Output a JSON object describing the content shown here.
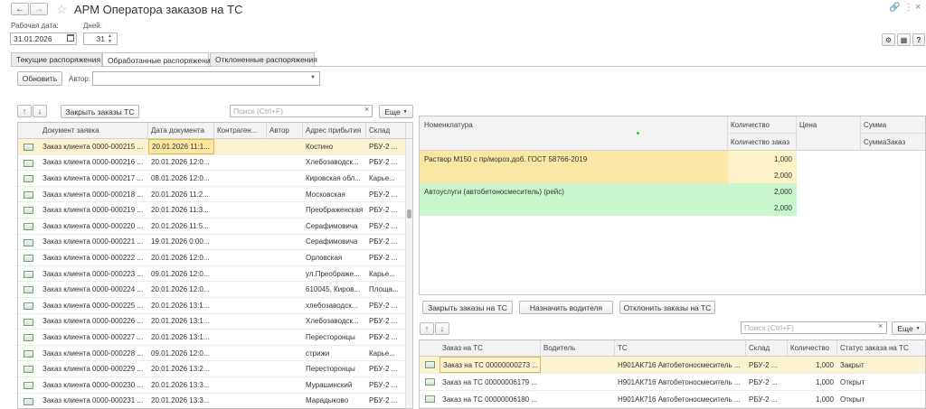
{
  "window": {
    "title": "АРМ Оператора заказов на ТС",
    "back_icon": "arrow-left-icon",
    "forward_icon": "arrow-right-icon",
    "star_icon": "star-icon"
  },
  "header": {
    "date_label": "Рабочая дата:",
    "date_value": "31.01.2026",
    "days_label": "Дней:",
    "days_value": "31"
  },
  "tabs": [
    {
      "label": "Текущие распоряжения"
    },
    {
      "label": "Обработанные распоряжения"
    },
    {
      "label": "Отклоненные распоряжения"
    }
  ],
  "toolbar": {
    "refresh_label": "Обновить",
    "author_label": "Автор:",
    "author_value": "",
    "close_orders_label": "Закрыть заказы ТС",
    "search_placeholder": "Поиск (Ctrl+F)",
    "more_label": "Еще"
  },
  "left_table": {
    "columns": [
      "Документ заявка",
      "Дата документа",
      "Контраген...",
      "Автор",
      "Адрес прибытия",
      "Склад"
    ],
    "rows": [
      [
        "Заказ клиента 0000-000215 ...",
        "20.01.2026 11:1...",
        "",
        "",
        "Костино",
        "РБУ-2 ..."
      ],
      [
        "Заказ клиента 0000-000216 ...",
        "20.01.2026 12:0...",
        "",
        "",
        "Хлебозаводск...",
        "РБУ-2 ..."
      ],
      [
        "Заказ клиента 0000-000217 ...",
        "08.01.2026 12:0...",
        "",
        "",
        "Кировская обл...",
        "Карье..."
      ],
      [
        "Заказ клиента 0000-000218 ...",
        "20.01.2026 11:2...",
        "",
        "",
        "Московская",
        "РБУ-2 ..."
      ],
      [
        "Заказ клиента 0000-000219 ...",
        "20.01.2026 11:3...",
        "",
        "",
        "Преображенская",
        "РБУ-2 ..."
      ],
      [
        "Заказ клиента 0000-000220 ...",
        "20.01.2026 11:5...",
        "",
        "",
        "Серафимовича",
        "РБУ-2 ..."
      ],
      [
        "Заказ клиента 0000-000221 ...",
        "19.01.2026 0:00...",
        "",
        "",
        "Серафимовича",
        "РБУ-2 ..."
      ],
      [
        "Заказ клиента 0000-000222 ...",
        "20.01.2026 12:0...",
        "",
        "",
        "Орловская",
        "РБУ-2 ..."
      ],
      [
        "Заказ клиента 0000-000223 ...",
        "09.01.2026 12:0...",
        "",
        "",
        "ул.Преображе...",
        "Карье..."
      ],
      [
        "Заказ клиента 0000-000224 ...",
        "20.01.2026 12:0...",
        "",
        "",
        "610045, Киров...",
        "Площа..."
      ],
      [
        "Заказ клиента 0000-000225 ...",
        "20.01.2026 13:1...",
        "",
        "",
        "хлебозаводск...",
        "РБУ-2 ..."
      ],
      [
        "Заказ клиента 0000-000226 ...",
        "20.01.2026 13:1...",
        "",
        "",
        "Хлебозаводск...",
        "РБУ-2 ..."
      ],
      [
        "Заказ клиента 0000-000227 ...",
        "20.01.2026 13:1...",
        "",
        "",
        "Пересторонцы",
        "РБУ-2 ..."
      ],
      [
        "Заказ клиента 0000-000228 ...",
        "09.01.2026 12:0...",
        "",
        "",
        "стрижи",
        "Карье..."
      ],
      [
        "Заказ клиента 0000-000229 ...",
        "20.01.2026 13:2...",
        "",
        "",
        "Пересторонцы",
        "РБУ-2 ..."
      ],
      [
        "Заказ клиента 0000-000230 ...",
        "20.01.2026 13:3...",
        "",
        "",
        "Мурашинский",
        "РБУ-2 ..."
      ],
      [
        "Заказ клиента 0000-000231 ...",
        "20.01.2026 13:3...",
        "",
        "",
        "Марадыково",
        "РБУ-2 ..."
      ]
    ]
  },
  "nomenclature": {
    "col_nom": "Номенклатура",
    "col_qty": "Количество",
    "col_qty_order": "Количество заказ",
    "col_price": "Цена",
    "col_sum": "Сумма",
    "col_sum_order": "СуммаЗаказ",
    "items": [
      {
        "name": "Раствор М150 с пр/мороз.доб. ГОСТ 58766-2019",
        "qty": "1,000",
        "qty_order": "2,000"
      },
      {
        "name": "Автоуслуги (автобетоносмеситель) (рейс)",
        "qty": "2,000",
        "qty_order": "2,000"
      }
    ]
  },
  "actions": {
    "close_orders": "Закрыть заказы на ТС",
    "assign_driver": "Назначить водителя",
    "reject_orders": "Отклонить заказы на ТС"
  },
  "bottom_table": {
    "columns": [
      "Заказ на ТС",
      "Водитель",
      "ТС",
      "Склад",
      "Количество",
      "Статус заказа на ТС"
    ],
    "rows": [
      [
        "Заказ на ТС 00000000273 ...",
        "",
        "H901АК716 Автобетоносмеситель ...",
        "РБУ-2 ...",
        "1,000",
        "Закрыт"
      ],
      [
        "Заказ на ТС 00000006179 ...",
        "",
        "H901АК716 Автобетоносмеситель ...",
        "РБУ-2 ...",
        "1,000",
        "Открыт"
      ],
      [
        "Заказ на ТС 00000006180 ...",
        "",
        "H901АК716 Автобетоносмеситель ...",
        "РБУ-2 ...",
        "1,000",
        "Открыт"
      ]
    ]
  }
}
